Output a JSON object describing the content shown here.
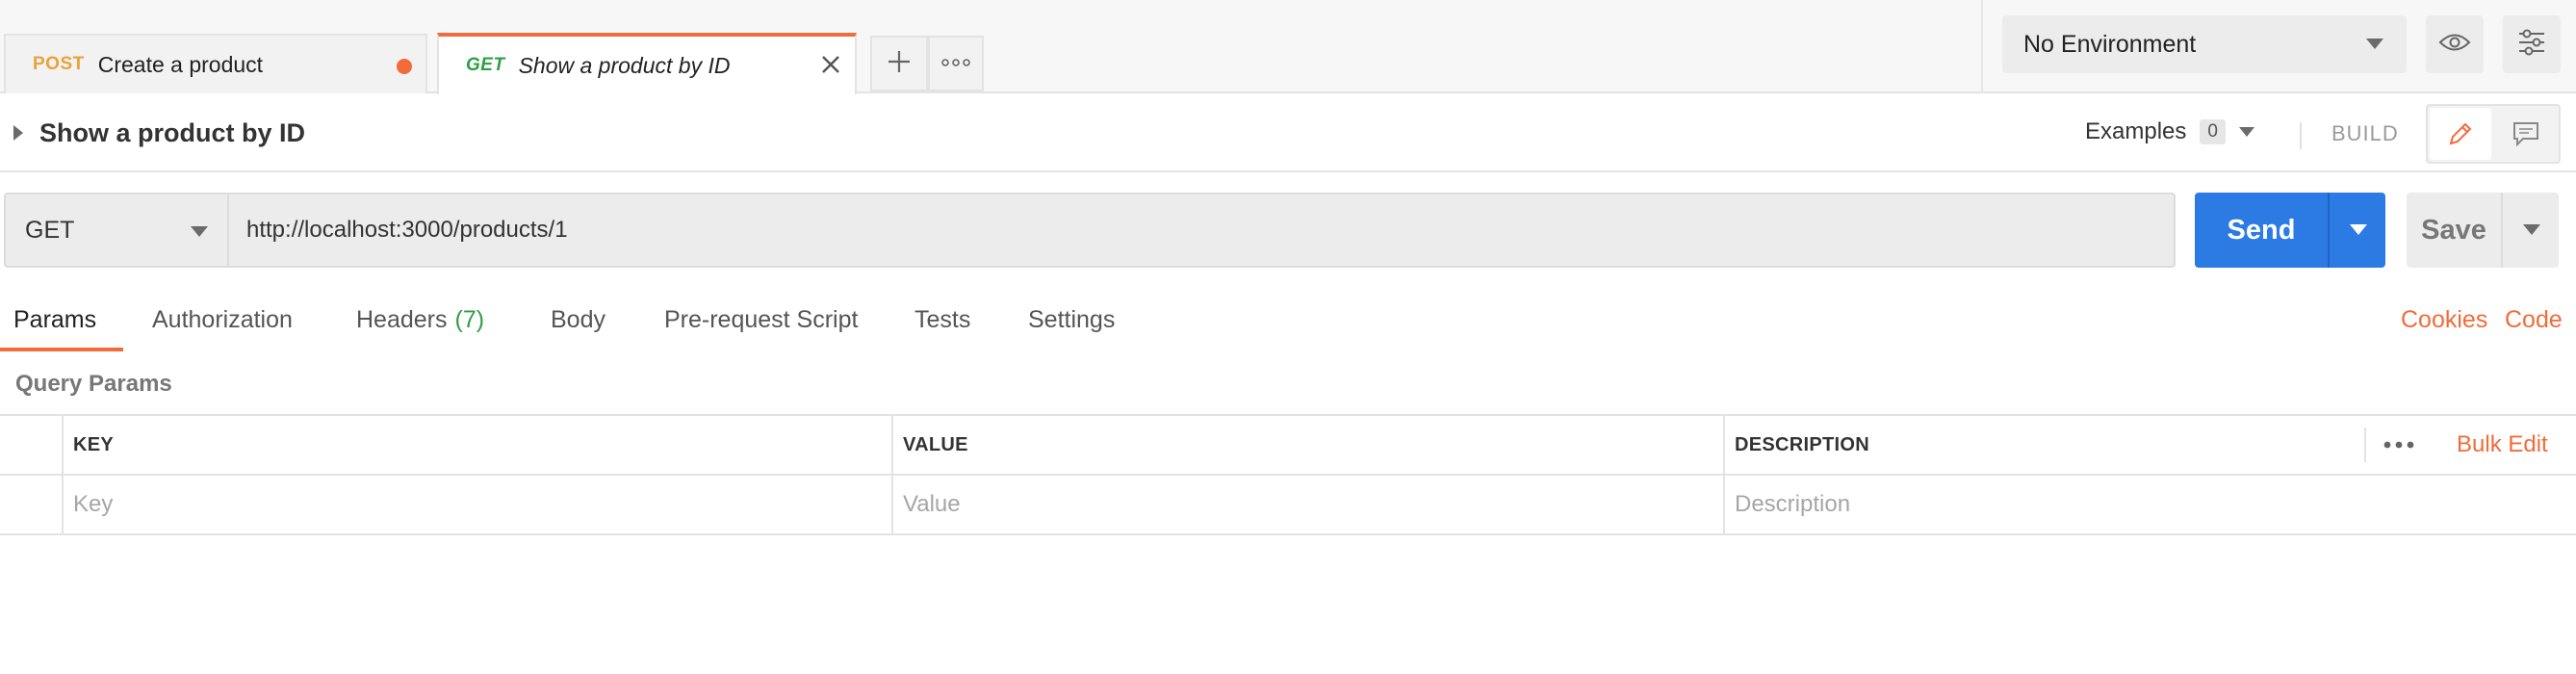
{
  "tabs": [
    {
      "method": "POST",
      "name": "Create a product",
      "unsaved": true
    },
    {
      "method": "GET",
      "name": "Show a product by ID",
      "active": true
    }
  ],
  "environment": {
    "selected": "No Environment"
  },
  "icons": {
    "add_tab": "plus-icon",
    "tab_options": "ellipsis-icon",
    "close_tab": "close-icon",
    "env_quick_look": "eye-icon",
    "env_settings": "sliders-icon",
    "edit": "pencil-icon",
    "comments": "comment-icon",
    "table_options": "ellipsis-icon"
  },
  "request": {
    "name": "Show a product by ID",
    "examples_label": "Examples",
    "examples_count": "0",
    "mode_label": "BUILD",
    "method": "GET",
    "url": "http://localhost:3000/products/1",
    "send_label": "Send",
    "save_label": "Save"
  },
  "subtabs": {
    "params": "Params",
    "authorization": "Authorization",
    "headers": "Headers",
    "headers_count": "(7)",
    "body": "Body",
    "prerequest": "Pre-request Script",
    "tests": "Tests",
    "settings": "Settings",
    "cookies": "Cookies",
    "code": "Code"
  },
  "params": {
    "section_title": "Query Params",
    "columns": {
      "key": "KEY",
      "value": "VALUE",
      "description": "DESCRIPTION"
    },
    "placeholders": {
      "key": "Key",
      "value": "Value",
      "description": "Description"
    },
    "bulk_edit": "Bulk Edit"
  },
  "colors": {
    "accent": "#f26b3a",
    "send_blue": "#2c7be5",
    "get_green": "#2f9e44",
    "post_orange": "#e8a33a"
  }
}
